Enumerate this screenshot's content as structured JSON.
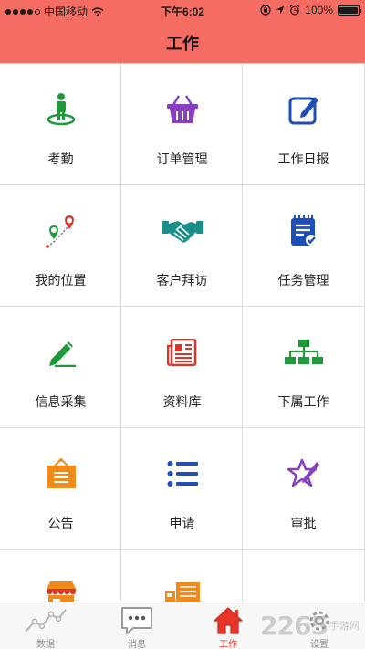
{
  "status_bar": {
    "carrier": "中国移动",
    "time": "下午6:02",
    "battery": "100%"
  },
  "header": {
    "title": "工作"
  },
  "colors": {
    "header_bg": "#f56c63",
    "tab_active": "#e8352a",
    "green": "#1f9a3a",
    "purple": "#8a3fc0",
    "blue": "#1e4fb8",
    "teal": "#1a8f8a",
    "red": "#d9362b",
    "orange": "#f08a1a"
  },
  "grid": {
    "items": [
      {
        "label": "考勤",
        "icon": "checkin-person-icon"
      },
      {
        "label": "订单管理",
        "icon": "shopping-basket-icon"
      },
      {
        "label": "工作日报",
        "icon": "edit-report-icon"
      },
      {
        "label": "我的位置",
        "icon": "location-pins-icon"
      },
      {
        "label": "客户拜访",
        "icon": "handshake-icon"
      },
      {
        "label": "任务管理",
        "icon": "task-clipboard-icon"
      },
      {
        "label": "信息采集",
        "icon": "pen-write-icon"
      },
      {
        "label": "资料库",
        "icon": "newspaper-icon"
      },
      {
        "label": "下属工作",
        "icon": "org-chart-icon"
      },
      {
        "label": "公告",
        "icon": "notice-board-icon"
      },
      {
        "label": "申请",
        "icon": "list-icon"
      },
      {
        "label": "审批",
        "icon": "star-edit-icon"
      },
      {
        "label": "",
        "icon": "store-icon"
      },
      {
        "label": "",
        "icon": "delivery-truck-icon"
      },
      {
        "label": "",
        "icon": ""
      }
    ]
  },
  "tabbar": {
    "tabs": [
      {
        "label": "数据",
        "icon": "line-chart-icon",
        "active": false
      },
      {
        "label": "消息",
        "icon": "chat-bubble-icon",
        "active": false
      },
      {
        "label": "工作",
        "icon": "home-icon",
        "active": true
      },
      {
        "label": "设置",
        "icon": "settings-icon",
        "active": false
      }
    ]
  },
  "watermark": {
    "number": "2265",
    "text": "手游网"
  }
}
